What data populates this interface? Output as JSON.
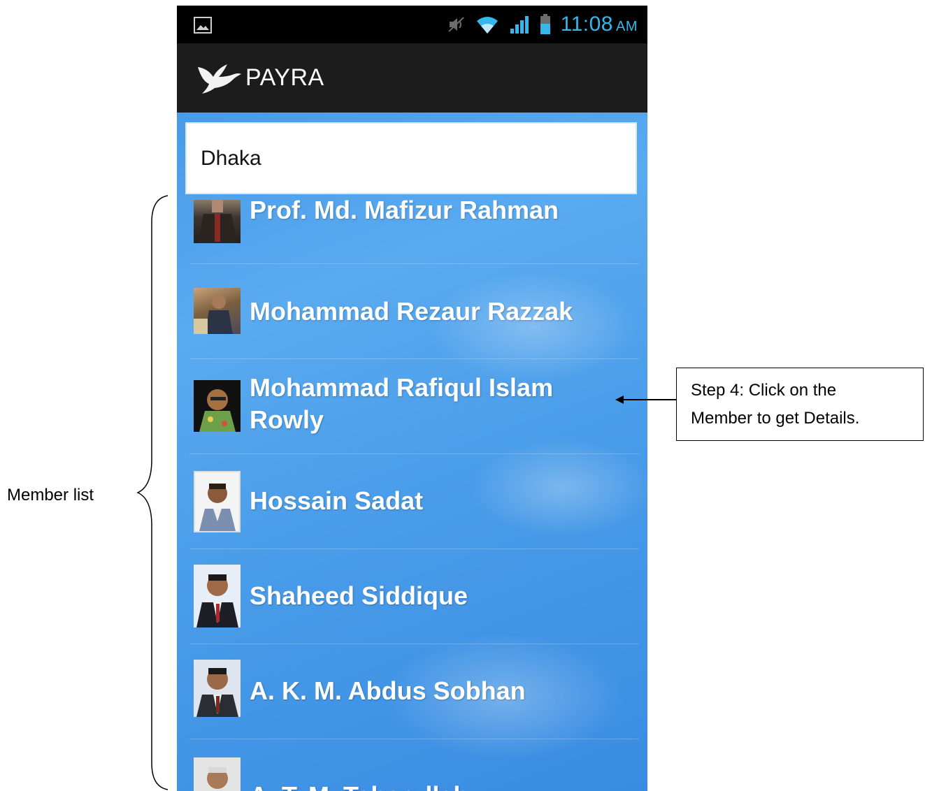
{
  "status_bar": {
    "time": "11:08",
    "ampm": "AM",
    "icons": [
      "gallery-icon",
      "mute-icon",
      "wifi-icon",
      "signal-icon",
      "battery-icon"
    ]
  },
  "app_bar": {
    "title": "PAYRA",
    "logo": "dove-logo-icon"
  },
  "search": {
    "value": "Dhaka"
  },
  "members": [
    {
      "name": "Prof. Md. Mafizur  Rahman"
    },
    {
      "name": "Mohammad Rezaur Razzak"
    },
    {
      "name": "Mohammad Rafiqul Islam\nRowly"
    },
    {
      "name": "Hossain Sadat"
    },
    {
      "name": "Shaheed Siddique"
    },
    {
      "name": "A. K. M. Abdus  Sobhan"
    },
    {
      "name": "A. T. M. Taherullah"
    }
  ],
  "annotations": {
    "member_list_label": "Member list",
    "callout_line1": "Step 4: Click on the",
    "callout_line2": "Member to get Details."
  },
  "colors": {
    "status_text": "#34b8ec",
    "list_bg": "#4a9de9",
    "actionbar_bg": "#1c1c1c"
  }
}
